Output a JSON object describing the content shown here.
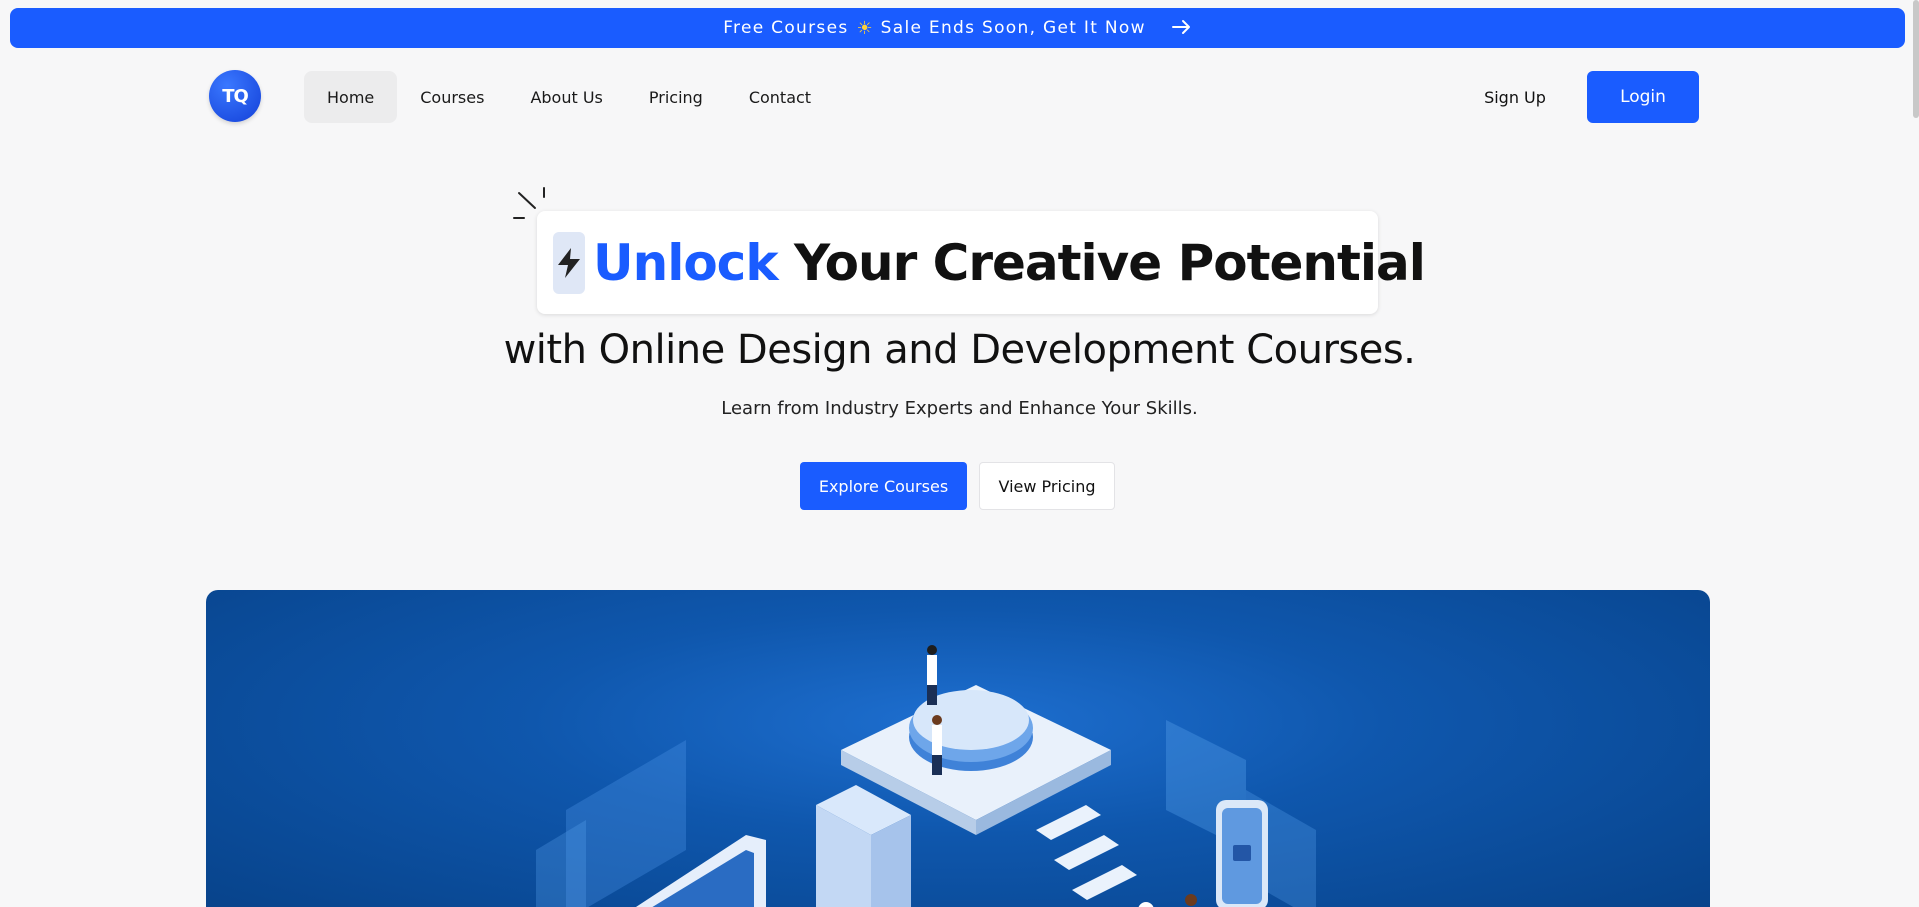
{
  "banner": {
    "text_before": "Free Courses",
    "emoji": "☀",
    "text_after": "Sale Ends Soon, Get It Now",
    "arrow_icon": "arrow-right-icon"
  },
  "brand": {
    "logo_text": "TQ"
  },
  "nav": {
    "items": [
      {
        "label": "Home",
        "active": true
      },
      {
        "label": "Courses",
        "active": false
      },
      {
        "label": "About Us",
        "active": false
      },
      {
        "label": "Pricing",
        "active": false
      },
      {
        "label": "Contact",
        "active": false
      }
    ],
    "signup_label": "Sign Up",
    "login_label": "Login"
  },
  "hero": {
    "headline_accent": "Unlock",
    "headline_rest": "Your Creative Potential",
    "subline": "with Online Design and Development Courses.",
    "tagline": "Learn from Industry Experts and Enhance Your Skills.",
    "primary_cta": "Explore Courses",
    "secondary_cta": "View Pricing",
    "icon": "lightning-bolt-icon"
  },
  "colors": {
    "accent": "#1a5cff",
    "background": "#f7f7f8",
    "hero_image_bg": "#0f57ad"
  }
}
